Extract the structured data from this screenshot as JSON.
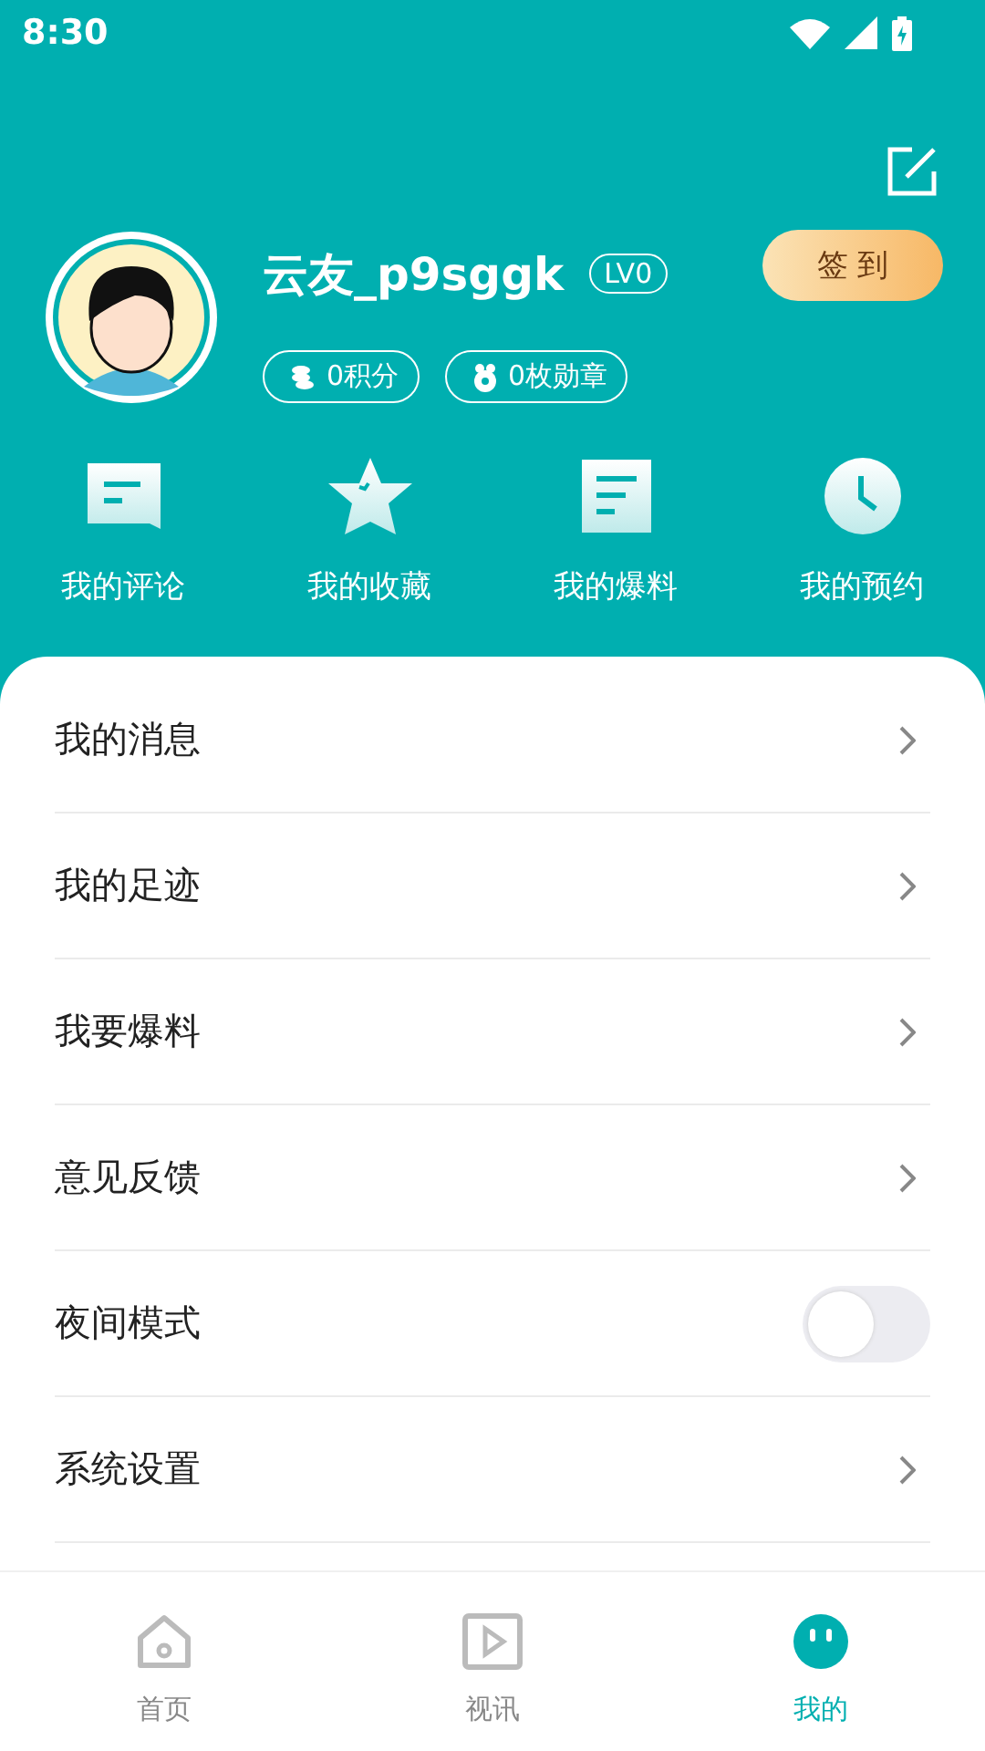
{
  "status_bar": {
    "time": "8:30"
  },
  "profile": {
    "username": "云友_p9sggk",
    "level_badge": "LV0",
    "checkin_button": "签 到",
    "stats": [
      {
        "kind": "points",
        "label": "0积分"
      },
      {
        "kind": "medals",
        "label": "0枚勋章"
      }
    ]
  },
  "shortcuts": [
    {
      "kind": "comment",
      "label": "我的评论"
    },
    {
      "kind": "star",
      "label": "我的收藏"
    },
    {
      "kind": "doc",
      "label": "我的爆料"
    },
    {
      "kind": "clock",
      "label": "我的预约"
    }
  ],
  "menu": [
    {
      "kind": "link",
      "label": "我的消息"
    },
    {
      "kind": "link",
      "label": "我的足迹"
    },
    {
      "kind": "link",
      "label": "我要爆料"
    },
    {
      "kind": "link",
      "label": "意见反馈"
    },
    {
      "kind": "toggle",
      "label": "夜间模式",
      "on": false
    },
    {
      "kind": "link",
      "label": "系统设置"
    }
  ],
  "tab_bar": [
    {
      "kind": "home",
      "label": "首页",
      "selected": false
    },
    {
      "kind": "video",
      "label": "视讯",
      "selected": false
    },
    {
      "kind": "me",
      "label": "我的",
      "selected": true
    }
  ]
}
